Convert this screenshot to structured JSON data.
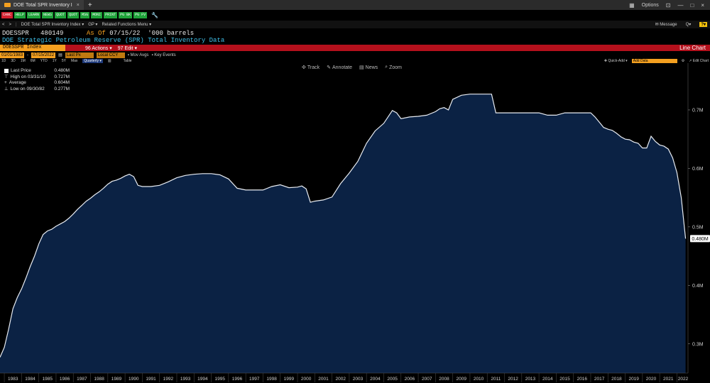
{
  "titlebar": {
    "tab_label": "DOE Total SPR Inventory I",
    "close": "×",
    "new_tab": "+",
    "options": "Options",
    "win_controls": [
      "⊡",
      "—",
      "□",
      "×"
    ]
  },
  "function_keys": [
    {
      "label": "CANC",
      "color": "red"
    },
    {
      "label": "HELP",
      "color": "green"
    },
    {
      "label": "LEARN",
      "color": "green"
    },
    {
      "label": "NEWS",
      "color": "green"
    },
    {
      "label": "QUOT",
      "color": "green"
    },
    {
      "label": "QUOT",
      "color": "green"
    },
    {
      "label": "MSG",
      "color": "green"
    },
    {
      "label": "MONI",
      "color": "green"
    },
    {
      "label": "PRINT",
      "color": "green"
    },
    {
      "label": "PG BK",
      "color": "green"
    },
    {
      "label": "PG FV",
      "color": "green"
    }
  ],
  "nav": {
    "back": "<",
    "forward": ">",
    "security_menu": "DOE Total SPR Inventory Index ▾",
    "gp": "GP ▾",
    "related": "Related Functions Menu ▾",
    "message": "Message",
    "q_icon": "Q▾",
    "help_box": "?▾"
  },
  "security": {
    "ticker": "DOESSPR",
    "value": "480149",
    "asof_label": "As Of",
    "asof_date": "07/15/22",
    "units": "'000 barrels",
    "description": "DOE Strategic Petroleum Reserve (SPR) Total Inventory Data"
  },
  "toolbar": {
    "ticker_field": "DOESSPR Index",
    "actions": "96 Actions ▾",
    "edit": "97 Edit ▾",
    "chart_type": "Line Chart"
  },
  "daterow": {
    "start": "01/01/1983",
    "end": "07/15/2022",
    "field": "Last Px",
    "currency": "Local CCY",
    "mov_avgs": "Mov Avgs",
    "key_events": "Key Events"
  },
  "periods": [
    "1D",
    "3D",
    "1M",
    "6M",
    "YTD",
    "1Y",
    "5Y",
    "Max"
  ],
  "period_selected": "Quarterly ▾",
  "table_label": "Table",
  "quick_add": "Quick-Add",
  "add_data": "Add Data",
  "edit_chart": "Edit Chart",
  "chart_tools": {
    "track": "Track",
    "annotate": "Annotate",
    "news": "News",
    "zoom": "Zoom"
  },
  "legend": {
    "last_price_label": "Last Price",
    "last_price_value": "0.480M",
    "high_label": "High on 03/31/10",
    "high_value": "0.727M",
    "avg_label": "Average",
    "avg_value": "0.604M",
    "low_label": "Low on 09/30/82",
    "low_value": "0.277M"
  },
  "last_value_badge": "0.480M",
  "colors": {
    "area_fill": "#0b2244",
    "line": "#e8ecf2",
    "accent_orange": "#f4a020",
    "toolbar_red": "#b4101c",
    "title_cyan": "#3fbfe8"
  },
  "chart_data": {
    "type": "area",
    "xlabel": "",
    "ylabel": "",
    "ylim": [
      0.25,
      0.78
    ],
    "yticks": [
      0.3,
      0.4,
      0.5,
      0.6,
      0.7
    ],
    "ytick_labels": [
      "0.3M",
      "0.4M",
      "0.5M",
      "0.6M",
      "0.7M"
    ],
    "xlim": [
      1982.75,
      2022.6
    ],
    "xticks": [
      1983,
      1984,
      1985,
      1986,
      1987,
      1988,
      1989,
      1990,
      1991,
      1992,
      1993,
      1994,
      1995,
      1996,
      1997,
      1998,
      1999,
      2000,
      2001,
      2002,
      2003,
      2004,
      2005,
      2006,
      2007,
      2008,
      2009,
      2010,
      2011,
      2012,
      2013,
      2014,
      2015,
      2016,
      2017,
      2018,
      2019,
      2020,
      2021,
      2022
    ],
    "x": [
      1982.75,
      1983.0,
      1983.25,
      1983.5,
      1983.75,
      1984.0,
      1984.25,
      1984.5,
      1984.75,
      1985.0,
      1985.25,
      1985.5,
      1985.75,
      1986.0,
      1986.25,
      1986.5,
      1986.75,
      1987.0,
      1987.25,
      1987.5,
      1987.75,
      1988.0,
      1988.25,
      1988.5,
      1988.75,
      1989.0,
      1989.25,
      1989.5,
      1989.75,
      1990.0,
      1990.25,
      1990.5,
      1990.75,
      1991.0,
      1991.5,
      1992.0,
      1992.5,
      1993.0,
      1993.5,
      1994.0,
      1994.5,
      1995.0,
      1995.5,
      1996.0,
      1996.5,
      1997.0,
      1997.5,
      1998.0,
      1998.5,
      1999.0,
      1999.5,
      2000.0,
      2000.25,
      2000.5,
      2000.75,
      2001.0,
      2001.5,
      2002.0,
      2002.5,
      2003.0,
      2003.5,
      2004.0,
      2004.5,
      2005.0,
      2005.25,
      2005.5,
      2005.75,
      2006.0,
      2006.5,
      2007.0,
      2007.5,
      2008.0,
      2008.25,
      2008.5,
      2008.75,
      2009.0,
      2009.5,
      2010.0,
      2010.25,
      2010.5,
      2011.0,
      2011.25,
      2011.5,
      2012.0,
      2012.5,
      2013.0,
      2013.5,
      2014.0,
      2014.5,
      2015.0,
      2015.5,
      2016.0,
      2016.5,
      2017.0,
      2017.25,
      2017.5,
      2017.75,
      2018.0,
      2018.25,
      2018.5,
      2018.75,
      2019.0,
      2019.25,
      2019.5,
      2019.75,
      2020.0,
      2020.25,
      2020.5,
      2020.75,
      2021.0,
      2021.25,
      2021.5,
      2021.75,
      2022.0,
      2022.25,
      2022.5
    ],
    "values": [
      0.277,
      0.294,
      0.325,
      0.36,
      0.379,
      0.394,
      0.412,
      0.432,
      0.45,
      0.471,
      0.487,
      0.493,
      0.496,
      0.501,
      0.505,
      0.509,
      0.515,
      0.522,
      0.53,
      0.537,
      0.544,
      0.549,
      0.555,
      0.56,
      0.566,
      0.573,
      0.578,
      0.58,
      0.583,
      0.587,
      0.59,
      0.586,
      0.571,
      0.569,
      0.569,
      0.571,
      0.577,
      0.584,
      0.588,
      0.59,
      0.591,
      0.591,
      0.589,
      0.582,
      0.566,
      0.563,
      0.563,
      0.563,
      0.569,
      0.572,
      0.567,
      0.568,
      0.57,
      0.565,
      0.542,
      0.544,
      0.546,
      0.551,
      0.574,
      0.592,
      0.612,
      0.643,
      0.664,
      0.677,
      0.688,
      0.699,
      0.695,
      0.685,
      0.688,
      0.689,
      0.691,
      0.697,
      0.702,
      0.704,
      0.7,
      0.718,
      0.725,
      0.727,
      0.727,
      0.727,
      0.727,
      0.727,
      0.695,
      0.695,
      0.695,
      0.695,
      0.695,
      0.695,
      0.691,
      0.691,
      0.695,
      0.695,
      0.695,
      0.695,
      0.688,
      0.679,
      0.67,
      0.667,
      0.665,
      0.66,
      0.654,
      0.65,
      0.649,
      0.645,
      0.643,
      0.635,
      0.635,
      0.655,
      0.646,
      0.64,
      0.638,
      0.633,
      0.618,
      0.593,
      0.55,
      0.48
    ]
  }
}
